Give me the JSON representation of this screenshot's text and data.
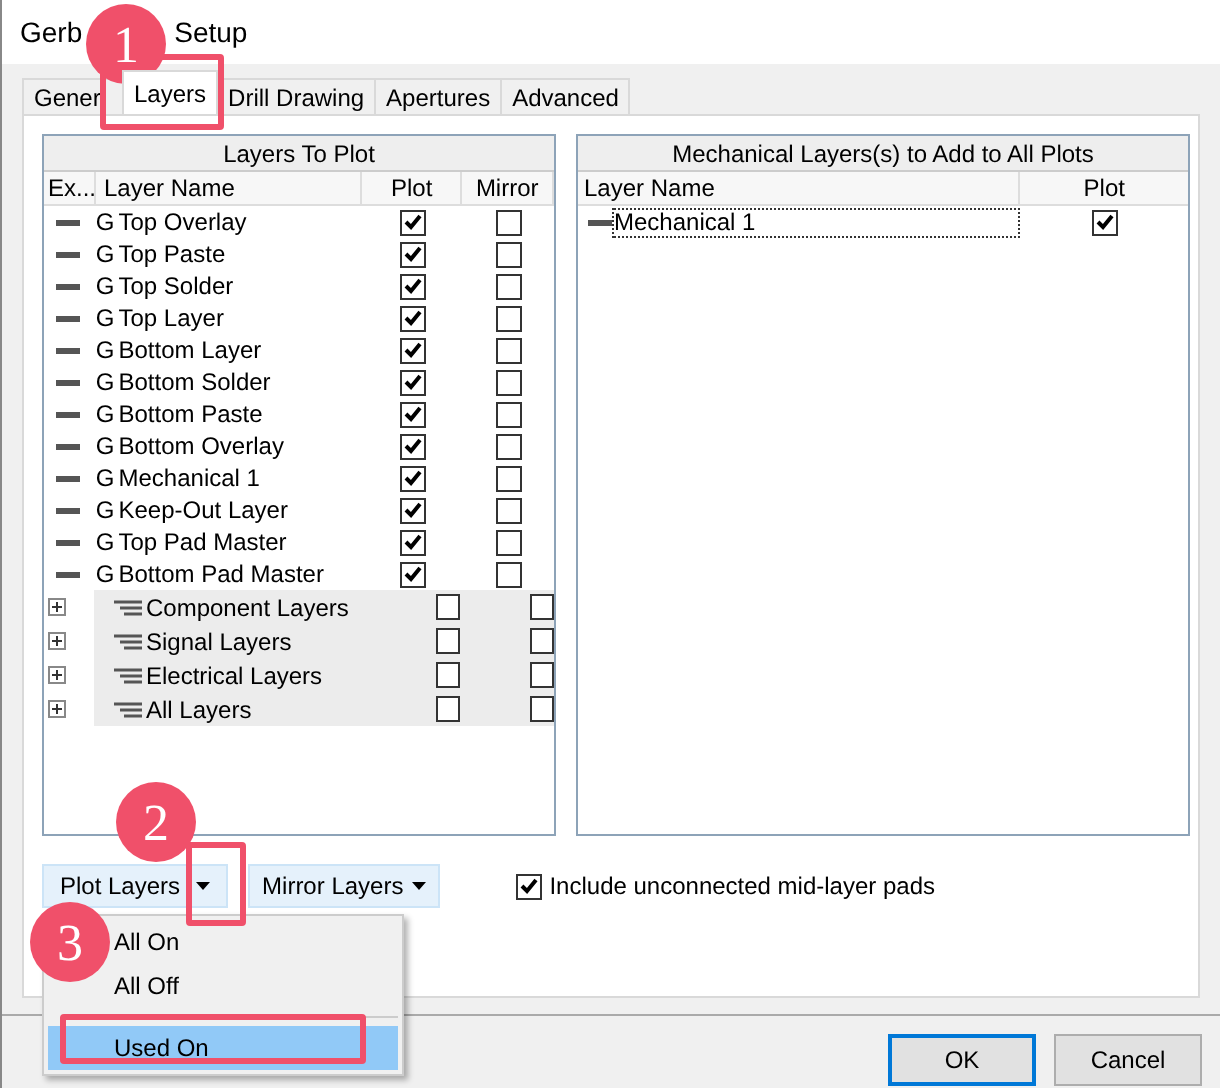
{
  "window": {
    "title": [
      "Gerb",
      "Setup"
    ]
  },
  "tabs": [
    {
      "label": "Gener",
      "selected": false
    },
    {
      "label": "Layers",
      "selected": true
    },
    {
      "label": "Drill Drawing",
      "selected": false
    },
    {
      "label": "Apertures",
      "selected": false
    },
    {
      "label": "Advanced",
      "selected": false
    }
  ],
  "layers_panel": {
    "title": "Layers To Plot",
    "columns": [
      "Ex...",
      "Layer Name",
      "Plot",
      "Mirror"
    ],
    "rows": [
      {
        "kind": "layer",
        "prefix": "G",
        "name": "Top Overlay",
        "plot": true,
        "mirror": false
      },
      {
        "kind": "layer",
        "prefix": "G",
        "name": "Top Paste",
        "plot": true,
        "mirror": false
      },
      {
        "kind": "layer",
        "prefix": "G",
        "name": "Top Solder",
        "plot": true,
        "mirror": false
      },
      {
        "kind": "layer",
        "prefix": "G",
        "name": "Top Layer",
        "plot": true,
        "mirror": false
      },
      {
        "kind": "layer",
        "prefix": "G",
        "name": "Bottom Layer",
        "plot": true,
        "mirror": false
      },
      {
        "kind": "layer",
        "prefix": "G",
        "name": "Bottom Solder",
        "plot": true,
        "mirror": false
      },
      {
        "kind": "layer",
        "prefix": "G",
        "name": "Bottom Paste",
        "plot": true,
        "mirror": false
      },
      {
        "kind": "layer",
        "prefix": "G",
        "name": "Bottom Overlay",
        "plot": true,
        "mirror": false
      },
      {
        "kind": "layer",
        "prefix": "G",
        "name": "Mechanical 1",
        "plot": true,
        "mirror": false
      },
      {
        "kind": "layer",
        "prefix": "G",
        "name": "Keep-Out Layer",
        "plot": true,
        "mirror": false
      },
      {
        "kind": "layer",
        "prefix": "G",
        "name": "Top Pad Master",
        "plot": true,
        "mirror": false
      },
      {
        "kind": "layer",
        "prefix": "G",
        "name": "Bottom Pad Master",
        "plot": true,
        "mirror": false
      },
      {
        "kind": "group",
        "name": "Component Layers",
        "expanded": false,
        "plot": false,
        "mirror": false
      },
      {
        "kind": "group",
        "name": "Signal Layers",
        "expanded": false,
        "plot": false,
        "mirror": false
      },
      {
        "kind": "group",
        "name": "Electrical Layers",
        "expanded": false,
        "plot": false,
        "mirror": false
      },
      {
        "kind": "group",
        "name": "All Layers",
        "expanded": false,
        "plot": false,
        "mirror": false
      }
    ]
  },
  "mechanical_panel": {
    "title": "Mechanical Layers(s) to Add to All Plots",
    "columns": [
      "Layer Name",
      "Plot"
    ],
    "rows": [
      {
        "name": "Mechanical 1",
        "plot": true,
        "selected": true
      }
    ]
  },
  "buttons_row": {
    "plot_layers": "Plot Layers",
    "mirror_layers": "Mirror Layers",
    "include_pads": {
      "label": "Include unconnected mid-layer pads",
      "checked": true
    }
  },
  "menu": [
    {
      "kind": "item",
      "label": "All On",
      "selected": false
    },
    {
      "kind": "item",
      "label": "All Off",
      "selected": false
    },
    {
      "kind": "separator"
    },
    {
      "kind": "item",
      "label": "Used On",
      "selected": true
    }
  ],
  "dialog_buttons": [
    {
      "label": "OK",
      "default": true
    },
    {
      "label": "Cancel",
      "default": false
    }
  ],
  "callouts": [
    "1",
    "2",
    "3"
  ]
}
